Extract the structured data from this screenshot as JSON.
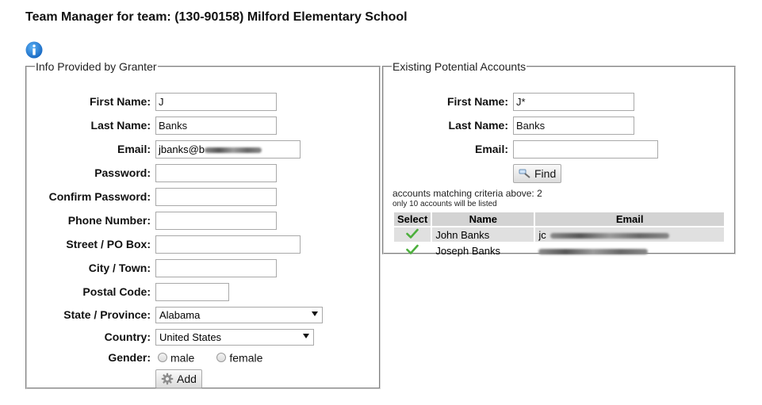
{
  "title": "Team Manager for team: (130-90158) Milford Elementary School",
  "granter": {
    "legend": "Info Provided by Granter",
    "fields": {
      "first_name": {
        "label": "First Name:",
        "value": "J"
      },
      "last_name": {
        "label": "Last Name:",
        "value": "Banks"
      },
      "email": {
        "label": "Email:",
        "value": "jbanks@b"
      },
      "password": {
        "label": "Password:",
        "value": ""
      },
      "confirm_password": {
        "label": "Confirm Password:",
        "value": ""
      },
      "phone": {
        "label": "Phone Number:",
        "value": ""
      },
      "street": {
        "label": "Street / PO Box:",
        "value": ""
      },
      "city": {
        "label": "City / Town:",
        "value": ""
      },
      "postal": {
        "label": "Postal Code:",
        "value": ""
      },
      "state": {
        "label": "State / Province:",
        "value": "Alabama"
      },
      "country": {
        "label": "Country:",
        "value": "United States"
      },
      "gender": {
        "label": "Gender:",
        "options": [
          "male",
          "female"
        ]
      }
    },
    "add_label": "Add"
  },
  "accounts": {
    "legend": "Existing Potential Accounts",
    "fields": {
      "first_name": {
        "label": "First Name:",
        "value": "J*"
      },
      "last_name": {
        "label": "Last Name:",
        "value": "Banks"
      },
      "email": {
        "label": "Email:",
        "value": ""
      }
    },
    "find_label": "Find",
    "matching_text": "accounts matching criteria above: 2",
    "limit_text": "only 10 accounts will be listed",
    "columns": [
      "Select",
      "Name",
      "Email"
    ],
    "rows": [
      {
        "name": "John Banks",
        "email": "jc"
      },
      {
        "name": "Joseph Banks",
        "email": ""
      }
    ]
  },
  "colors": {
    "check": "#4caf3c",
    "info_icon": "#1a73c8",
    "header_bg": "#d3d3d3"
  }
}
